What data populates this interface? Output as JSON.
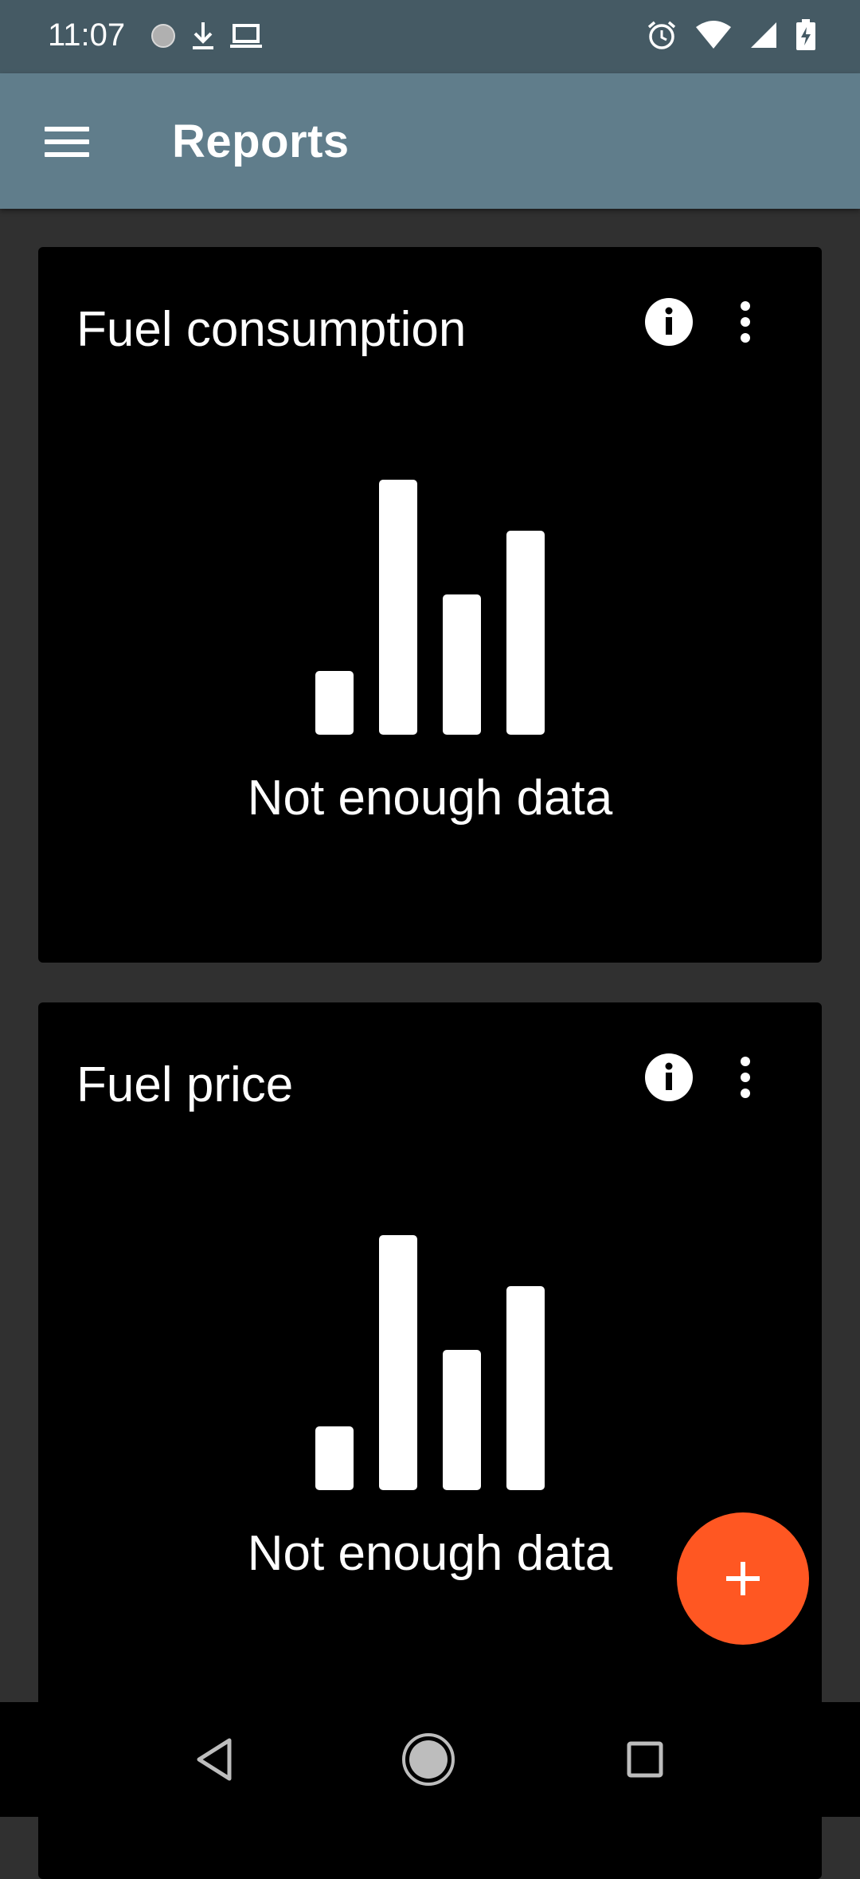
{
  "status_bar": {
    "time": "11:07",
    "left_icons": [
      "data-saver-icon",
      "download-icon",
      "laptop-icon"
    ],
    "right_icons": [
      "alarm-icon",
      "wifi-icon",
      "cell-signal-icon",
      "battery-charging-icon"
    ]
  },
  "app_bar": {
    "title": "Reports",
    "menu_icon": "hamburger-menu-icon"
  },
  "cards": [
    {
      "title": "Fuel consumption",
      "empty_text": "Not enough data"
    },
    {
      "title": "Fuel price",
      "empty_text": "Not enough data"
    }
  ],
  "fab": {
    "icon": "plus-icon",
    "color": "#ff5722"
  },
  "colors": {
    "status_bar": "#455a64",
    "app_bar": "#607d8b",
    "background": "#303030",
    "card": "#000000",
    "accent": "#ff5722"
  },
  "nav_bar": {
    "icons": [
      "back-icon",
      "home-icon",
      "recents-icon"
    ]
  }
}
